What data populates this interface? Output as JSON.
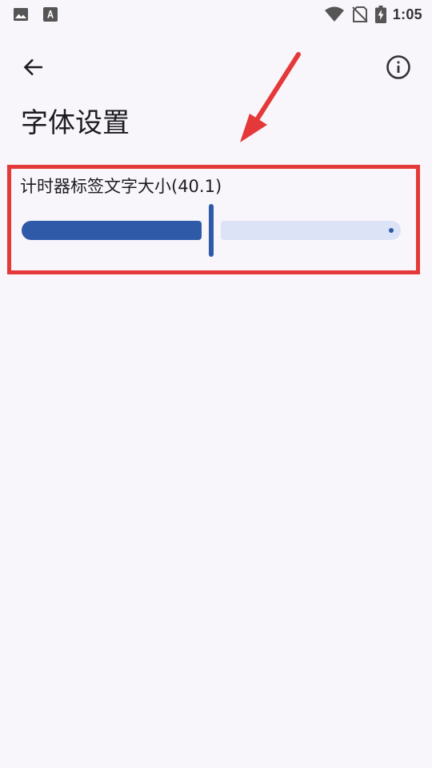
{
  "status_bar": {
    "time": "1:05",
    "left_icons": [
      "image-icon",
      "font-download-icon"
    ],
    "right_icons": [
      "wifi-icon",
      "no-sim-icon",
      "battery-charging-icon"
    ]
  },
  "app_bar": {
    "back_icon": "arrow-back-icon",
    "info_icon": "info-icon",
    "title": "字体设置"
  },
  "settings": {
    "timer_label_font_size": {
      "label": "计时器标签文字大小(40.1)",
      "value_fraction": 0.5
    }
  },
  "colors": {
    "background": "#f8f5fb",
    "slider_active": "#2e5aa8",
    "slider_inactive": "#dde3f7",
    "annotation": "#e53838"
  }
}
